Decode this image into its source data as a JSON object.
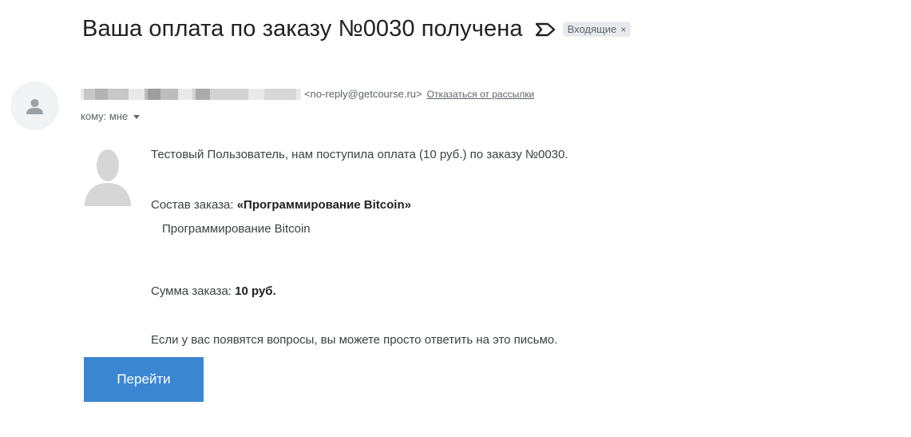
{
  "email": {
    "subject": "Ваша оплата по заказу №0030 получена",
    "label": "Входящие",
    "label_close": "×",
    "sender_email": "<no-reply@getcourse.ru>",
    "unsubscribe": "Отказаться от рассылки",
    "to_line": "кому: мне"
  },
  "body": {
    "greeting": "Тестовый Пользователь, нам поступила оплата (10 руб.) по заказу №0030.",
    "order_label": "Состав заказа: ",
    "order_name": "«Программирование Bitcoin»",
    "order_item": "Программирование Bitcoin",
    "sum_label": "Сумма заказа: ",
    "sum_value": "10 руб.",
    "questions": "Если у вас появятся вопросы, вы можете просто ответить на это письмо."
  },
  "button": {
    "label": "Перейти"
  },
  "icons": {
    "importance": "importance-marker-icon",
    "avatar": "person-icon",
    "dropdown": "caret-down-icon"
  },
  "colors": {
    "button_bg": "#3b86d1",
    "chip_bg": "#e8eaed",
    "muted_text": "#5f6368"
  }
}
